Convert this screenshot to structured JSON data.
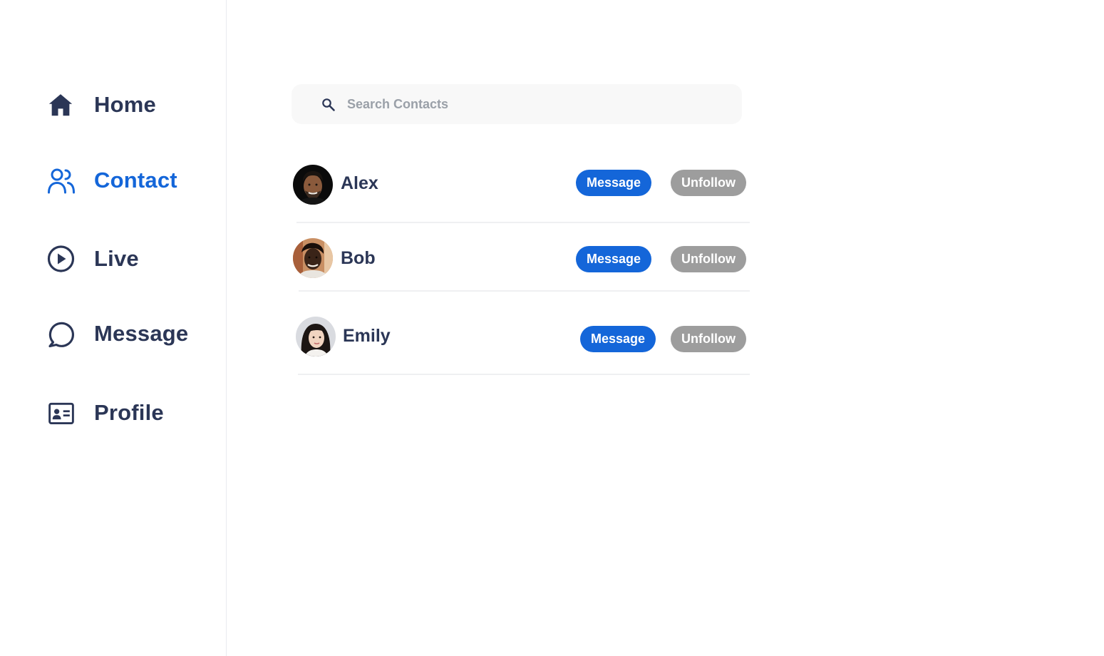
{
  "sidebar": {
    "items": [
      {
        "label": "Home",
        "icon": "home-icon",
        "active": false
      },
      {
        "label": "Contact",
        "icon": "users-icon",
        "active": true
      },
      {
        "label": "Live",
        "icon": "play-circle-icon",
        "active": false
      },
      {
        "label": "Message",
        "icon": "chat-bubble-icon",
        "active": false
      },
      {
        "label": "Profile",
        "icon": "id-card-icon",
        "active": false
      }
    ]
  },
  "search": {
    "placeholder": "Search Contacts",
    "value": ""
  },
  "contacts": [
    {
      "name": "Alex",
      "message_label": "Message",
      "unfollow_label": "Unfollow"
    },
    {
      "name": "Bob",
      "message_label": "Message",
      "unfollow_label": "Unfollow"
    },
    {
      "name": "Emily",
      "message_label": "Message",
      "unfollow_label": "Unfollow"
    }
  ],
  "colors": {
    "accent": "#1466d9",
    "text": "#2b3656",
    "muted_button": "#9d9d9d",
    "search_bg": "#f8f8f8"
  }
}
